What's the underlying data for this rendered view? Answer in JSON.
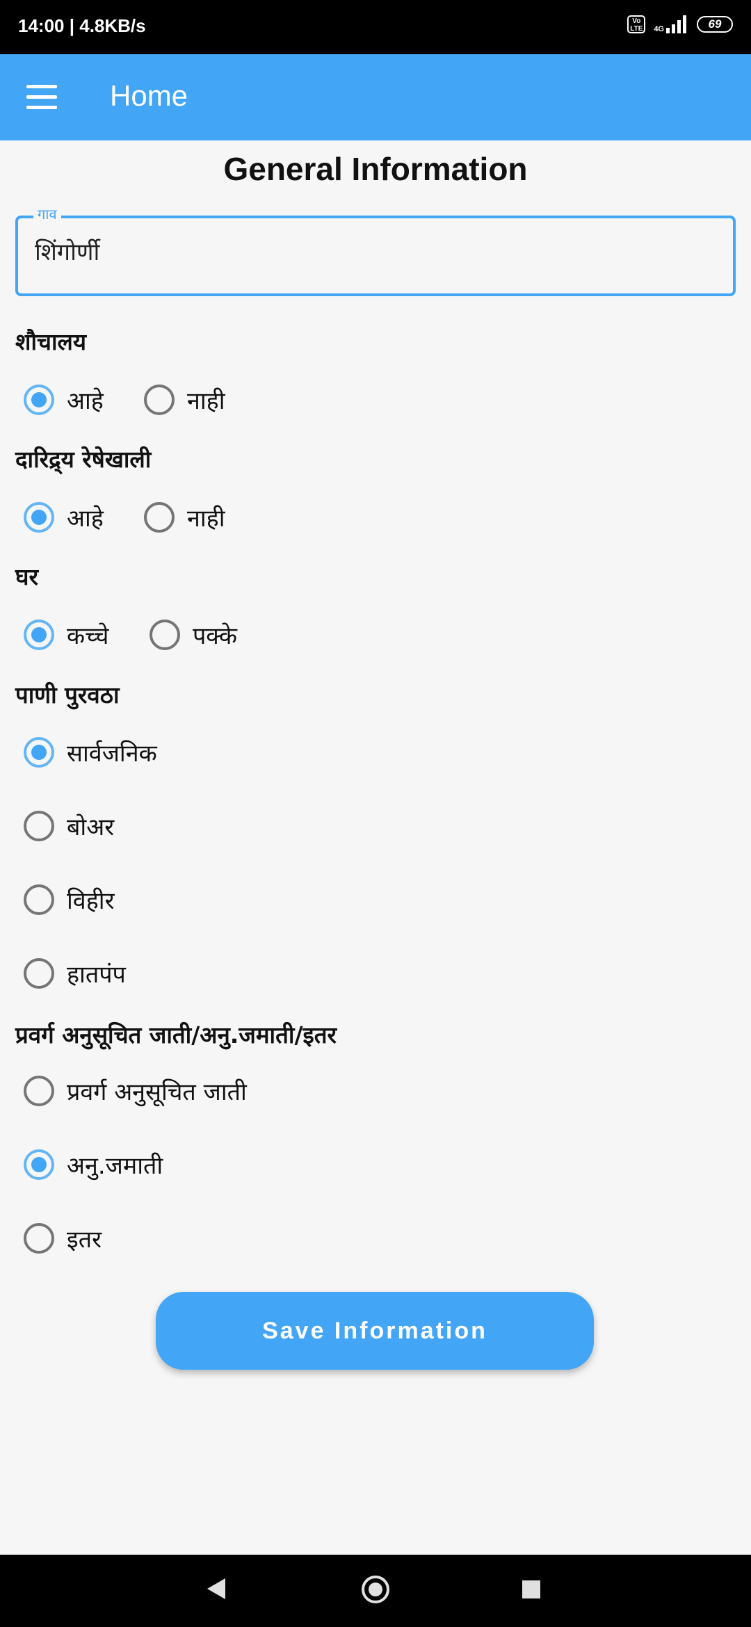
{
  "status_bar": {
    "time": "14:00",
    "speed": "4.8KB/s",
    "volte": "Vo LTE",
    "network": "4G",
    "battery": "69"
  },
  "app_bar": {
    "title": "Home",
    "menu_icon": "hamburger-menu-icon"
  },
  "form": {
    "title": "General Information",
    "village": {
      "label": "गाव",
      "value": "शिंगोर्णी"
    },
    "toilet": {
      "label": "शौचालय",
      "options": [
        "आहे",
        "नाही"
      ],
      "selected": "आहे"
    },
    "below_poverty": {
      "label": "दारिद्र्य रेषेखाली",
      "options": [
        "आहे",
        "नाही"
      ],
      "selected": "आहे"
    },
    "house": {
      "label": "घर",
      "options": [
        "कच्चे",
        "पक्के"
      ],
      "selected": "कच्चे"
    },
    "water_supply": {
      "label": "पाणी पुरवठा",
      "options": [
        "सार्वजनिक",
        "बोअर",
        "विहीर",
        "हातपंप"
      ],
      "selected": "सार्वजनिक"
    },
    "category": {
      "label": "प्रवर्ग अनुसूचित जाती/अनु.जमाती/इतर",
      "options": [
        "प्रवर्ग अनुसूचित जाती",
        "अनु.जमाती",
        "इतर"
      ],
      "selected": "अनु.जमाती"
    },
    "save_label": "Save Information"
  },
  "nav_bar": {
    "back_icon": "back-triangle-icon",
    "home_icon": "home-circle-icon",
    "recents_icon": "recents-square-icon"
  },
  "colors": {
    "accent": "#42a5f5",
    "radio_selected": "#64b5f6",
    "radio_unselected": "#757575",
    "background": "#f6f6f6"
  }
}
